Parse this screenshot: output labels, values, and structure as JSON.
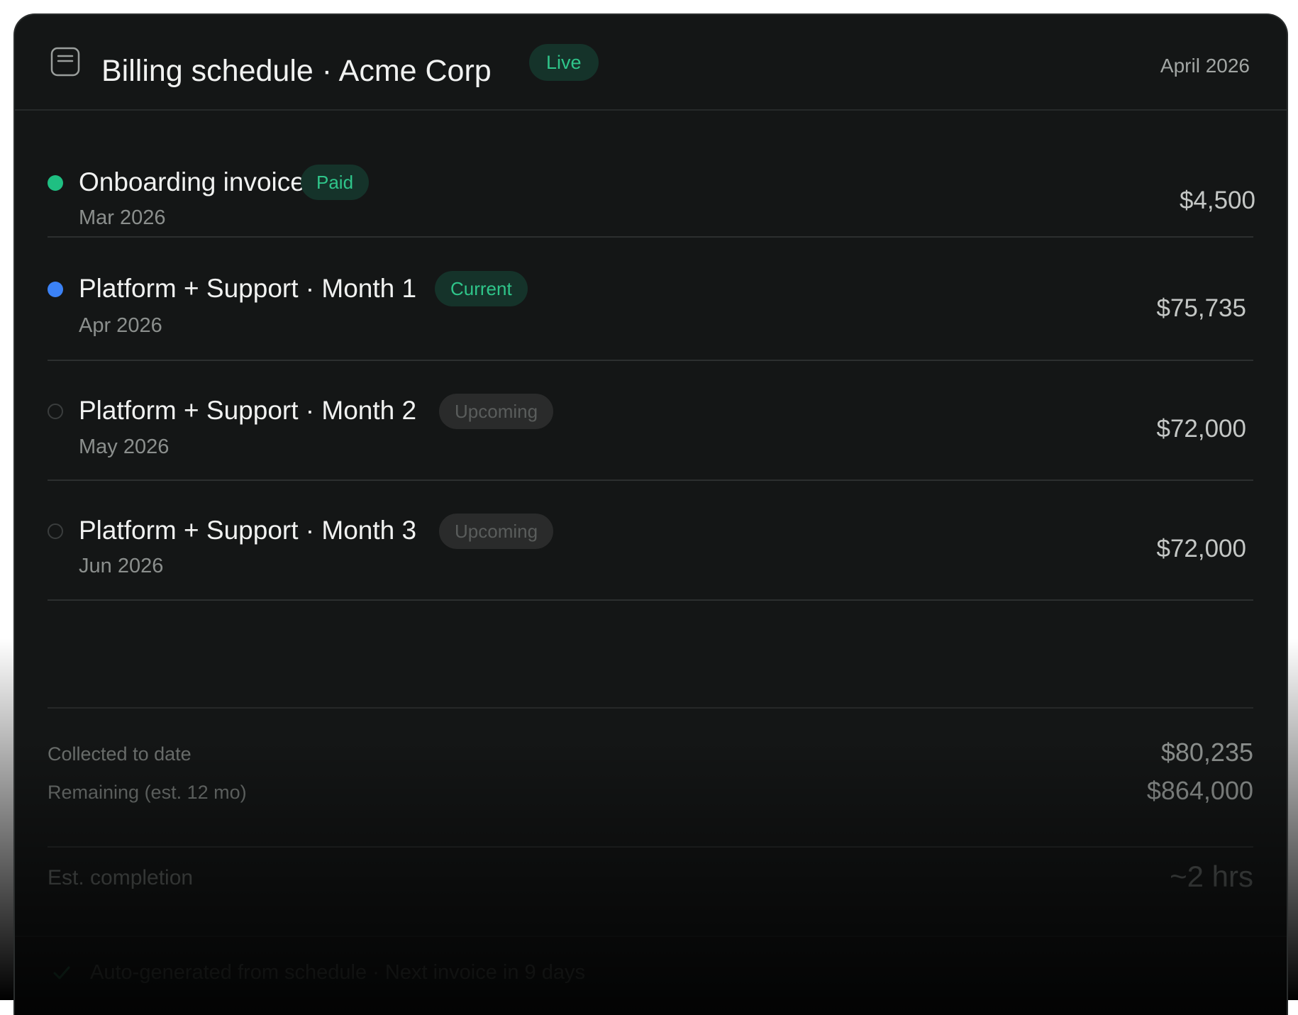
{
  "header": {
    "title": "Billing schedule · Acme Corp",
    "status": "Live",
    "date": "April 2026"
  },
  "rows": [
    {
      "title": "Onboarding invoice",
      "status": "Paid",
      "date": "Mar 2026",
      "amount": "$4,500"
    },
    {
      "title": "Platform + Support · Month 1",
      "status": "Current",
      "date": "Apr 2026",
      "amount": "$75,735"
    },
    {
      "title": "Platform + Support · Month 2",
      "status": "Upcoming",
      "date": "May 2026",
      "amount": "$72,000"
    },
    {
      "title": "Platform + Support · Month 3",
      "status": "Upcoming",
      "date": "Jun 2026",
      "amount": "$72,000"
    }
  ],
  "summary": {
    "collected_label": "Collected to date",
    "collected_value": "$80,235",
    "remaining_label": "Remaining (est. 12 mo)",
    "remaining_value": "$864,000",
    "eta_label": "Est. completion",
    "eta_value": "~2 hrs"
  },
  "footer": {
    "note": "Auto-generated from schedule · Next invoice in 9 days"
  },
  "colors": {
    "paid": "#1fbf82",
    "current": "#3b82f6",
    "badge_green": "#2fc58a",
    "background": "#141616"
  }
}
